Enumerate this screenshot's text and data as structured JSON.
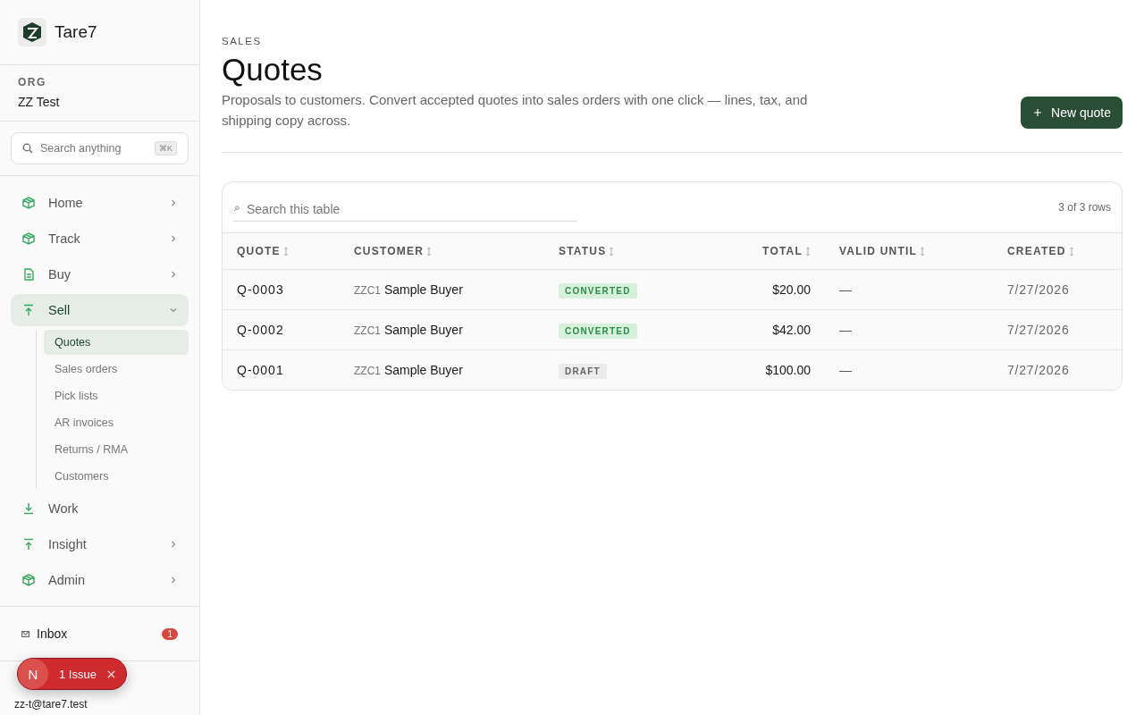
{
  "brand": {
    "name": "Tare7"
  },
  "org": {
    "label": "ORG",
    "name": "ZZ Test"
  },
  "search": {
    "placeholder": "Search anything",
    "shortcut": "⌘K"
  },
  "nav": [
    {
      "label": "Home",
      "kind": "group",
      "expanded": false,
      "selected": false
    },
    {
      "label": "Track",
      "kind": "group",
      "expanded": false,
      "selected": false
    },
    {
      "label": "Buy",
      "kind": "group",
      "expanded": false,
      "selected": false
    },
    {
      "label": "Sell",
      "kind": "group",
      "expanded": true,
      "selected": true,
      "children": [
        {
          "label": "Quotes",
          "selected": true
        },
        {
          "label": "Sales orders",
          "selected": false
        },
        {
          "label": "Pick lists",
          "selected": false
        },
        {
          "label": "AR invoices",
          "selected": false
        },
        {
          "label": "Returns / RMA",
          "selected": false
        },
        {
          "label": "Customers",
          "selected": false
        }
      ]
    },
    {
      "label": "Work",
      "kind": "link",
      "selected": false
    },
    {
      "label": "Insight",
      "kind": "group",
      "expanded": false,
      "selected": false
    },
    {
      "label": "Admin",
      "kind": "group",
      "expanded": false,
      "selected": false
    }
  ],
  "inbox": {
    "label": "Inbox",
    "count": "1"
  },
  "user": {
    "email": "zz-t@tare7.test"
  },
  "toast": {
    "avatar": "N",
    "label": "1 Issue"
  },
  "page": {
    "eyebrow": "SALES",
    "title": "Quotes",
    "description": "Proposals to customers. Convert accepted quotes into sales orders with one click — lines, tax, and shipping copy across.",
    "action": "New quote"
  },
  "table": {
    "search_placeholder": "Search this table",
    "row_count": "3 of 3 rows",
    "columns": [
      {
        "label": "QUOTE"
      },
      {
        "label": "CUSTOMER"
      },
      {
        "label": "STATUS"
      },
      {
        "label": "TOTAL"
      },
      {
        "label": "VALID UNTIL"
      },
      {
        "label": "CREATED"
      }
    ],
    "rows": [
      {
        "quote": "Q-0003",
        "customer_code": "ZZC1",
        "customer": "Sample Buyer",
        "status": {
          "label": "CONVERTED",
          "kind": "converted"
        },
        "total": "$20.00",
        "valid_until": "—",
        "created": "7/27/2026"
      },
      {
        "quote": "Q-0002",
        "customer_code": "ZZC1",
        "customer": "Sample Buyer",
        "status": {
          "label": "CONVERTED",
          "kind": "converted"
        },
        "total": "$42.00",
        "valid_until": "—",
        "created": "7/27/2026"
      },
      {
        "quote": "Q-0001",
        "customer_code": "ZZC1",
        "customer": "Sample Buyer",
        "status": {
          "label": "DRAFT",
          "kind": "draft"
        },
        "total": "$100.00",
        "valid_until": "—",
        "created": "7/27/2026"
      }
    ]
  }
}
